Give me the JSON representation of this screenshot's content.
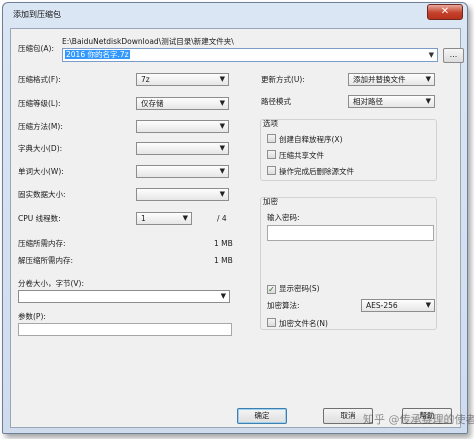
{
  "window": {
    "title": "添加到压缩包",
    "close_glyph": "✕"
  },
  "archive": {
    "label": "压缩包(A):",
    "path": "E:\\BaiduNetdiskDownload\\测试目录\\新建文件夹\\",
    "name": "2016 你的名字.7z",
    "browse_label": "..."
  },
  "left_options": {
    "format_label": "压缩格式(F):",
    "format_value": "7z",
    "level_label": "压缩等级(L):",
    "level_value": "仅存储",
    "method_label": "压缩方法(M):",
    "method_value": "",
    "dict_label": "字典大小(D):",
    "dict_value": "",
    "word_label": "单词大小(W):",
    "word_value": "",
    "solid_label": "固实数据大小:",
    "solid_value": "",
    "threads_label": "CPU 线程数:",
    "threads_value": "1",
    "threads_total": "/ 4",
    "mem_compress_label": "压缩所需内存:",
    "mem_compress_value": "1 MB",
    "mem_decompress_label": "解压缩所需内存:",
    "mem_decompress_value": "1 MB",
    "split_label": "分卷大小，字节(V):",
    "split_value": "",
    "params_label": "参数(P):",
    "params_value": ""
  },
  "right_options": {
    "update_label": "更新方式(U):",
    "update_value": "添加并替换文件",
    "path_mode_label": "路径模式",
    "path_mode_value": "相对路径",
    "options_title": "选项",
    "options": [
      {
        "label": "创建自释放程序(X)",
        "checked": false
      },
      {
        "label": "压缩共享文件",
        "checked": false
      },
      {
        "label": "操作完成后删除源文件",
        "checked": false
      }
    ],
    "encryption_title": "加密",
    "password_label": "输入密码:",
    "password_value": "",
    "show_password_label": "显示密码(S)",
    "show_password_checked": true,
    "method_label": "加密算法:",
    "method_value": "AES-256",
    "encrypt_names_label": "加密文件名(N)",
    "encrypt_names_checked": false
  },
  "buttons": {
    "ok": "确定",
    "cancel": "取消",
    "help": "帮助"
  },
  "watermark": "知乎 @传承赛理的使者"
}
